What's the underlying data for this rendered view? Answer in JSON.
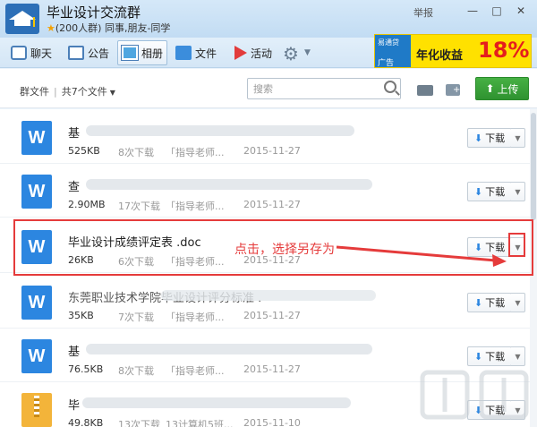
{
  "window": {
    "group_name": "毕业设计交流群",
    "member_info": "(200人群) 同事,朋友-同学",
    "report": "举报",
    "minimize_label": "—",
    "maximize_label": "□",
    "close_label": "✕"
  },
  "tabs": [
    {
      "label": "聊天"
    },
    {
      "label": "公告"
    },
    {
      "label": "相册"
    },
    {
      "label": "文件"
    },
    {
      "label": "活动"
    }
  ],
  "ad": {
    "logo": "易通贷",
    "tag": "广告",
    "label": "年化收益",
    "percent": "18%"
  },
  "filebar": {
    "root": "群文件",
    "count": "共7个文件",
    "search_placeholder": "搜索",
    "upload_label": "上传"
  },
  "files": [
    {
      "name": "基",
      "size": "525KB",
      "downloads": "8次下载",
      "uploader": "「指导老师...",
      "date": "2015-11-27",
      "type": "word"
    },
    {
      "name": "查",
      "size": "2.90MB",
      "downloads": "17次下载",
      "uploader": "「指导老师...",
      "date": "2015-11-27",
      "type": "word"
    },
    {
      "name": "毕业设计成绩评定表 .doc",
      "size": "26KB",
      "downloads": "6次下载",
      "uploader": "「指导老师...",
      "date": "2015-11-27",
      "type": "word"
    },
    {
      "name": "东莞职业技术学院毕业设计评分标准 .",
      "size": "35KB",
      "downloads": "7次下载",
      "uploader": "「指导老师...",
      "date": "2015-11-27",
      "type": "word"
    },
    {
      "name": "基",
      "size": "76.5KB",
      "downloads": "8次下载",
      "uploader": "「指导老师...",
      "date": "2015-11-27",
      "type": "word"
    },
    {
      "name": "毕",
      "size": "49.8KB",
      "downloads": "13次下载",
      "uploader": "13计算机5班...",
      "date": "2015-11-10",
      "type": "zip"
    }
  ],
  "download_label": "下载",
  "annotation": {
    "hint": "点击，选择另存为",
    "color": "#e53b3b"
  },
  "colors": {
    "accent": "#2c86e0",
    "upload": "#3a9e39"
  }
}
